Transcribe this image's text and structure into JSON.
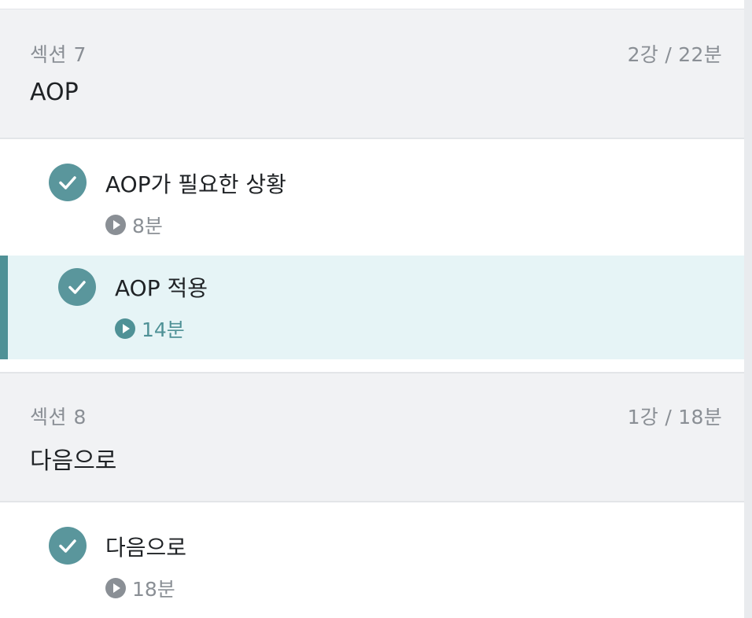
{
  "sections": [
    {
      "label": "섹션 7",
      "meta": "2강 / 22분",
      "title": "AOP",
      "lessons": [
        {
          "title": "AOP가 필요한 상황",
          "duration": "8분",
          "status_icon": "check-icon",
          "play_icon": "play-icon",
          "active": false
        },
        {
          "title": "AOP 적용",
          "duration": "14분",
          "status_icon": "check-icon",
          "play_icon": "play-icon",
          "active": true
        }
      ]
    },
    {
      "label": "섹션 8",
      "meta": "1강 / 18분",
      "title": "다음으로",
      "lessons": [
        {
          "title": "다음으로",
          "duration": "18분",
          "status_icon": "check-icon",
          "play_icon": "play-icon",
          "active": false
        }
      ]
    }
  ],
  "colors": {
    "accent": "#5a969c",
    "active_background": "#e6f4f6",
    "section_background": "#f1f2f4",
    "muted_text": "#8a8f95",
    "primary_text": "#1f2225"
  }
}
